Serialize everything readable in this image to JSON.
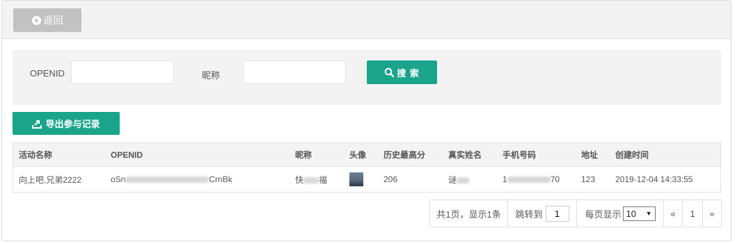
{
  "toolbar": {
    "back_label": "返回"
  },
  "filters": {
    "openid_label": "OPENID",
    "openid_value": "",
    "nickname_label": "昵称",
    "nickname_value": "",
    "search_label": "搜 索"
  },
  "export_label": "导出参与记录",
  "table": {
    "headers": [
      "活动名称",
      "OPENID",
      "昵称",
      "头像",
      "历史最高分",
      "真实姓名",
      "手机号码",
      "地址",
      "创建时间"
    ],
    "rows": [
      {
        "activity": "向上吧,兄弟2222",
        "openid_start": "oSn",
        "openid_end": "CrnBk",
        "nickname_start": "快",
        "nickname_end": "福",
        "avatar": "avatar-image",
        "best_score": "206",
        "real_name_start": "谜",
        "phone_start": "1",
        "phone_end": "70",
        "address": "123",
        "created_at": "2019-12-04 14:33:55"
      }
    ]
  },
  "pagination": {
    "summary": "共1页，显示1条",
    "jump_label": "跳转到",
    "jump_value": "1",
    "per_page_label": "每页显示",
    "per_page_value": "10",
    "prev": "«",
    "current_page": "1",
    "next": "»"
  },
  "colors": {
    "primary": "#1aa58b",
    "back_button": "#c2c2c2",
    "panel": "#f3f3f3"
  }
}
